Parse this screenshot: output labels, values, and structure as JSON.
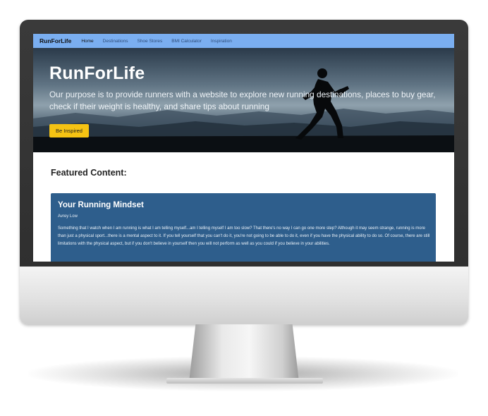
{
  "navbar": {
    "brand": "RunForLife",
    "links": [
      {
        "label": "Home",
        "active": true
      },
      {
        "label": "Destinations",
        "active": false
      },
      {
        "label": "Shoe Stores",
        "active": false
      },
      {
        "label": "BMI Calculator",
        "active": false
      },
      {
        "label": "Inspiration",
        "active": false
      }
    ]
  },
  "hero": {
    "title": "RunForLife",
    "description": "Our purpose is to provide runners with a website to explore new running destinations, places to buy gear, check if their weight is healthy, and share tips about running",
    "button_label": "Be Inspired"
  },
  "featured": {
    "heading": "Featured Content:",
    "card": {
      "title": "Your Running Mindset",
      "author": "Avrey Low",
      "body": "Something that I watch when I am running is what I am telling myself...am I telling myself I am too slow? That there's no way I can go one more step? Although it may seem strange, running is more than just a physical sport...there is a mental aspect to it. If you tell yourself that you can't do it, you're not going to be able to do it, even if you have the physical ability to do so. Of course, there are still limitations with the physical aspect, but if you don't believe in yourself then you will not perform as well as you could if you believe in your abilities."
    }
  },
  "colors": {
    "navbar_bg": "#7aaef0",
    "button_bg": "#f5c313",
    "card_bg": "#2e5e8c"
  },
  "icons": {
    "hero_graphic": "runner-silhouette-icon"
  }
}
